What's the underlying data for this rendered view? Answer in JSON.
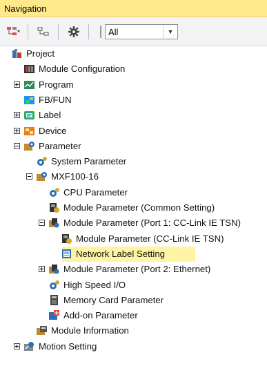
{
  "panel": {
    "title": "Navigation"
  },
  "toolbar": {
    "filter_value": "All"
  },
  "tree": [
    {
      "label": "Project",
      "icon": "project-icon",
      "level": 0,
      "expander": "none"
    },
    {
      "label": "Module Configuration",
      "icon": "module-configuration-icon",
      "level": 1,
      "expander": "none"
    },
    {
      "label": "Program",
      "icon": "program-icon",
      "level": 1,
      "expander": "plus"
    },
    {
      "label": "FB/FUN",
      "icon": "fb-fun-icon",
      "level": 1,
      "expander": "none"
    },
    {
      "label": "Label",
      "icon": "label-icon",
      "level": 1,
      "expander": "plus"
    },
    {
      "label": "Device",
      "icon": "device-icon",
      "level": 1,
      "expander": "plus"
    },
    {
      "label": "Parameter",
      "icon": "parameter-icon",
      "level": 1,
      "expander": "minus"
    },
    {
      "label": "System Parameter",
      "icon": "system-parameter-icon",
      "level": 2,
      "expander": "none"
    },
    {
      "label": "MXF100-16",
      "icon": "cpu-model-icon",
      "level": 2,
      "expander": "minus"
    },
    {
      "label": "CPU Parameter",
      "icon": "cpu-parameter-icon",
      "level": 3,
      "expander": "none"
    },
    {
      "label": "Module Parameter (Common Setting)",
      "icon": "module-parameter-icon",
      "level": 3,
      "expander": "none"
    },
    {
      "label": "Module Parameter (Port 1: CC-Link IE TSN)",
      "icon": "module-parameter-port-icon",
      "level": 3,
      "expander": "minus"
    },
    {
      "label": "Module Parameter (CC-Link IE TSN)",
      "icon": "module-parameter-icon",
      "level": 4,
      "expander": "none"
    },
    {
      "label": "Network Label Setting",
      "icon": "network-label-icon",
      "level": 4,
      "expander": "none",
      "selected": true
    },
    {
      "label": "Module Parameter (Port 2: Ethernet)",
      "icon": "module-parameter-port-icon",
      "level": 3,
      "expander": "plus"
    },
    {
      "label": "High Speed I/O",
      "icon": "high-speed-io-icon",
      "level": 3,
      "expander": "none"
    },
    {
      "label": "Memory Card Parameter",
      "icon": "memory-card-icon",
      "level": 3,
      "expander": "none"
    },
    {
      "label": "Add-on Parameter",
      "icon": "add-on-icon",
      "level": 3,
      "expander": "none"
    },
    {
      "label": "Module Information",
      "icon": "module-information-icon",
      "level": 2,
      "expander": "none"
    },
    {
      "label": "Motion Setting",
      "icon": "motion-setting-icon",
      "level": 1,
      "expander": "plus"
    }
  ]
}
